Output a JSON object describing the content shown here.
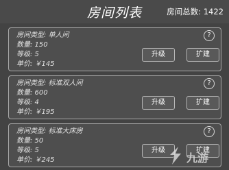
{
  "header": {
    "title": "房间列表",
    "total_label": "房间总数: 1422"
  },
  "rooms": [
    {
      "type": "房间类型: 单人间",
      "count": "数量: 150",
      "level": "等级: 5",
      "price": "单价: ￥145",
      "help": "?",
      "upgrade_label": "升级",
      "expand_label": "扩建"
    },
    {
      "type": "房间类型: 标准双人间",
      "count": "数量: 600",
      "level": "等级: 4",
      "price": "单价: ￥195",
      "help": "?",
      "upgrade_label": "升级",
      "expand_label": "扩建"
    },
    {
      "type": "房间类型: 标准大床房",
      "count": "数量: 50",
      "level": "等级: 5",
      "price": "单价: ￥245",
      "help": "?",
      "upgrade_label": "升级",
      "expand_label": "扩建"
    }
  ],
  "watermark": {
    "logo": "九游"
  },
  "colors": {
    "background": "#434343",
    "header": "#4a4a4a",
    "card": "#4e4e4e",
    "card_border": "#a9a9a9",
    "button": "#595959"
  },
  "icons": [
    "help-icon",
    "watermark-logo-icon"
  ]
}
